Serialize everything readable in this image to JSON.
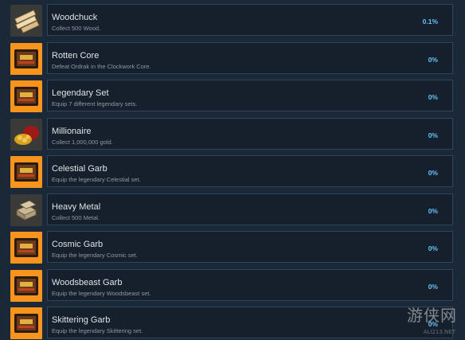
{
  "achievements": [
    {
      "icon": "wood-planks-icon",
      "title": "Woodchuck",
      "description": "Collect 500 Wood.",
      "percent": "0.1%"
    },
    {
      "icon": "orange-badge-icon",
      "title": "Rotten Core",
      "description": "Defeat Ordrak in the Clockwork Core.",
      "percent": "0%"
    },
    {
      "icon": "orange-badge-icon",
      "title": "Legendary Set",
      "description": "Equip 7 different legendary sets.",
      "percent": "0%"
    },
    {
      "icon": "gold-coins-icon",
      "title": "Millionaire",
      "description": "Collect 1,000,000 gold.",
      "percent": "0%"
    },
    {
      "icon": "orange-badge-icon",
      "title": "Celestial Garb",
      "description": "Equip the legendary Celestial set.",
      "percent": "0%"
    },
    {
      "icon": "metal-ingots-icon",
      "title": "Heavy Metal",
      "description": "Collect 500 Metal.",
      "percent": "0%"
    },
    {
      "icon": "orange-badge-icon",
      "title": "Cosmic Garb",
      "description": "Equip the legendary Cosmic set.",
      "percent": "0%"
    },
    {
      "icon": "orange-badge-icon",
      "title": "Woodsbeast Garb",
      "description": "Equip the legendary Woodsbeast set.",
      "percent": "0%"
    },
    {
      "icon": "orange-badge-icon",
      "title": "Skittering Garb",
      "description": "Equip the legendary Skittering set.",
      "percent": "0%"
    }
  ],
  "watermark": {
    "text": "游侠网",
    "sub": "ALI213.NET"
  },
  "colors": {
    "background": "#1b2838",
    "card": "#16202d",
    "card_border": "#2a475e",
    "accent": "#67c1f5",
    "badge_orange": "#f7941d"
  }
}
